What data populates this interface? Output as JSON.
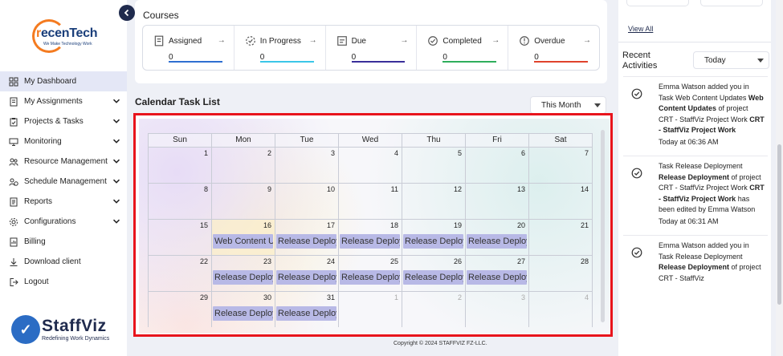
{
  "brand": {
    "top_logo_text_prefix": "r",
    "top_logo_text_main": "ecenTech",
    "top_logo_tagline": "We Make Technology Work",
    "bottom_logo_name": "StaffViz",
    "bottom_logo_tagline": "Redefining Work Dynamics"
  },
  "sidebar": {
    "items": [
      {
        "label": "My Dashboard",
        "icon": "dashboard-icon",
        "active": true,
        "expandable": false
      },
      {
        "label": "My Assignments",
        "icon": "assignments-icon",
        "active": false,
        "expandable": true
      },
      {
        "label": "Projects & Tasks",
        "icon": "clipboard-icon",
        "active": false,
        "expandable": true
      },
      {
        "label": "Monitoring",
        "icon": "monitor-icon",
        "active": false,
        "expandable": true
      },
      {
        "label": "Resource Management",
        "icon": "people-icon",
        "active": false,
        "expandable": true
      },
      {
        "label": "Schedule Management",
        "icon": "schedule-icon",
        "active": false,
        "expandable": true
      },
      {
        "label": "Reports",
        "icon": "report-icon",
        "active": false,
        "expandable": true
      },
      {
        "label": "Configurations",
        "icon": "config-icon",
        "active": false,
        "expandable": true
      },
      {
        "label": "Billing",
        "icon": "billing-icon",
        "active": false,
        "expandable": false
      },
      {
        "label": "Download client",
        "icon": "download-icon",
        "active": false,
        "expandable": false
      },
      {
        "label": "Logout",
        "icon": "logout-icon",
        "active": false,
        "expandable": false
      }
    ]
  },
  "courses": {
    "title": "Courses",
    "stats": [
      {
        "label": "Assigned",
        "value": "0",
        "color": "#2f6fd1",
        "icon": "assigned-icon"
      },
      {
        "label": "In Progress",
        "value": "0",
        "color": "#3bc6e8",
        "icon": "progress-icon"
      },
      {
        "label": "Due",
        "value": "0",
        "color": "#3a2f9a",
        "icon": "due-icon"
      },
      {
        "label": "Completed",
        "value": "0",
        "color": "#2fae5c",
        "icon": "completed-icon"
      },
      {
        "label": "Overdue",
        "value": "0",
        "color": "#e0432c",
        "icon": "overdue-icon"
      }
    ]
  },
  "calendar": {
    "title": "Calendar Task List",
    "range_select": "This Month",
    "weekdays": [
      "Sun",
      "Mon",
      "Tue",
      "Wed",
      "Thu",
      "Fri",
      "Sat"
    ],
    "weeks": [
      [
        {
          "d": "",
          "o": false,
          "e": ""
        },
        {
          "d": "1",
          "o": false,
          "e": ""
        },
        {
          "d": "2",
          "o": false,
          "e": ""
        },
        {
          "d": "3",
          "o": false,
          "e": ""
        },
        {
          "d": "4",
          "o": false,
          "e": ""
        },
        {
          "d": "5",
          "o": false,
          "e": ""
        },
        {
          "d": "6",
          "o": false,
          "e": ""
        },
        {
          "d": "7",
          "o": false,
          "e": ""
        }
      ],
      [
        {
          "d": "8",
          "o": false,
          "e": ""
        },
        {
          "d": "9",
          "o": false,
          "e": ""
        },
        {
          "d": "10",
          "o": false,
          "e": ""
        },
        {
          "d": "11",
          "o": false,
          "e": ""
        },
        {
          "d": "12",
          "o": false,
          "e": ""
        },
        {
          "d": "13",
          "o": false,
          "e": ""
        },
        {
          "d": "14",
          "o": false,
          "e": ""
        }
      ],
      [
        {
          "d": "15",
          "o": false,
          "e": ""
        },
        {
          "d": "16",
          "o": false,
          "e": "Web Content Updates",
          "t": true
        },
        {
          "d": "17",
          "o": false,
          "e": "Release Deployment"
        },
        {
          "d": "18",
          "o": false,
          "e": "Release Deployment"
        },
        {
          "d": "19",
          "o": false,
          "e": "Release Deployment"
        },
        {
          "d": "20",
          "o": false,
          "e": "Release Deployment"
        },
        {
          "d": "21",
          "o": false,
          "e": ""
        }
      ],
      [
        {
          "d": "22",
          "o": false,
          "e": ""
        },
        {
          "d": "23",
          "o": false,
          "e": "Release Deployment"
        },
        {
          "d": "24",
          "o": false,
          "e": "Release Deployment"
        },
        {
          "d": "25",
          "o": false,
          "e": "Release Deployment"
        },
        {
          "d": "26",
          "o": false,
          "e": "Release Deployment"
        },
        {
          "d": "27",
          "o": false,
          "e": "Release Deployment"
        },
        {
          "d": "28",
          "o": false,
          "e": ""
        }
      ],
      [
        {
          "d": "29",
          "o": false,
          "e": ""
        },
        {
          "d": "30",
          "o": false,
          "e": "Release Deployment"
        },
        {
          "d": "31",
          "o": false,
          "e": "Release Deployment"
        },
        {
          "d": "1",
          "o": true,
          "e": ""
        },
        {
          "d": "2",
          "o": true,
          "e": ""
        },
        {
          "d": "3",
          "o": true,
          "e": ""
        },
        {
          "d": "4",
          "o": true,
          "e": ""
        }
      ]
    ]
  },
  "footer": {
    "copyright": "Copyright © 2024 STAFFVIZ FZ-LLC."
  },
  "right_panel": {
    "view_all": "View All",
    "recent_title": "Recent Activities",
    "filter": "Today",
    "activities": [
      {
        "parts": [
          {
            "t": "Emma Watson added you in Task Web Content Updates ",
            "b": false
          },
          {
            "t": "Web Content Updates",
            "b": true
          },
          {
            "t": " of project CRT - StaffViz Project Work ",
            "b": false
          },
          {
            "t": "CRT - StaffViz Project Work",
            "b": true
          }
        ],
        "time": "Today at 06:36 AM"
      },
      {
        "parts": [
          {
            "t": "Task Release Deployment ",
            "b": false
          },
          {
            "t": "Release Deployment",
            "b": true
          },
          {
            "t": " of project CRT - StaffViz Project Work ",
            "b": false
          },
          {
            "t": "CRT - StaffViz Project Work",
            "b": true
          },
          {
            "t": " has been edited by Emma Watson",
            "b": false
          }
        ],
        "time": "Today at 06:31 AM"
      },
      {
        "parts": [
          {
            "t": "Emma Watson added you in Task Release Deployment ",
            "b": false
          },
          {
            "t": "Release Deployment",
            "b": true
          },
          {
            "t": " of project CRT - StaffViz",
            "b": false
          }
        ],
        "time": ""
      }
    ]
  }
}
